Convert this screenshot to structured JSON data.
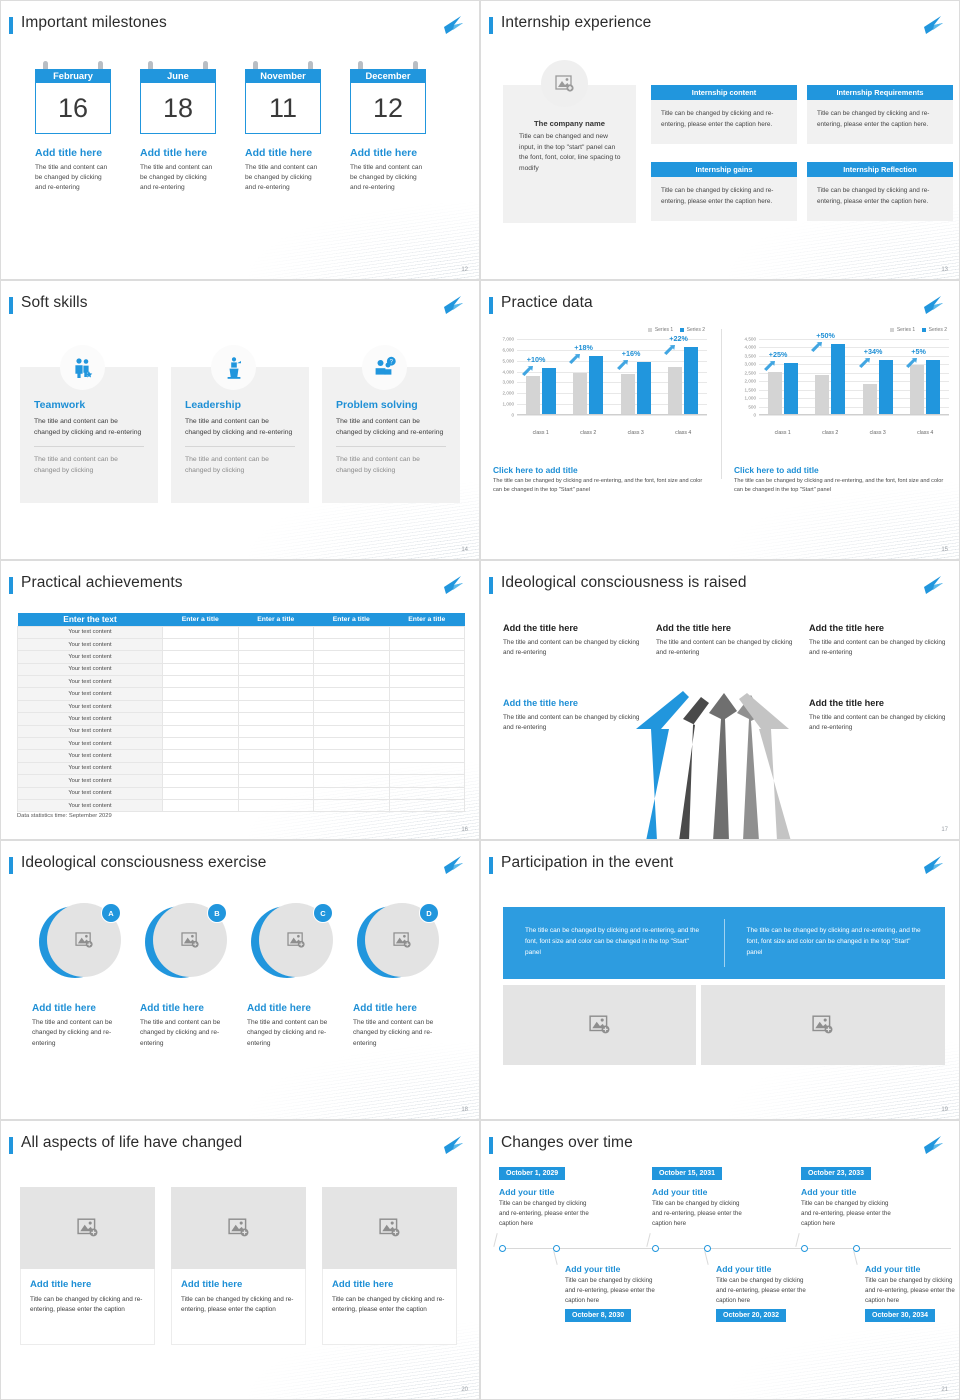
{
  "theme": {
    "accent": "#2196dd",
    "accent_dark": "#1e8fd5",
    "panel_gray": "#f1f1f1",
    "image_gray": "#e4e4e4"
  },
  "slides": [
    {
      "number": "12",
      "title": "Important milestones",
      "calendars": [
        {
          "month": "February",
          "day": "16",
          "title": "Add title here",
          "desc": "The title and content can be changed by clicking and re-entering"
        },
        {
          "month": "June",
          "day": "18",
          "title": "Add title here",
          "desc": "The title and content can be changed by clicking and re-entering"
        },
        {
          "month": "November",
          "day": "11",
          "title": "Add title here",
          "desc": "The title and content can be changed by clicking and re-entering"
        },
        {
          "month": "December",
          "day": "12",
          "title": "Add title here",
          "desc": "The title and content can be changed by clicking and re-entering"
        }
      ]
    },
    {
      "number": "13",
      "title": "Internship experience",
      "company": {
        "name": "The company name",
        "desc": "Title can be changed and new input, in the top \"start\" panel can the font, font, color, line spacing to modify"
      },
      "cells": [
        {
          "head": "Internship content",
          "body": "Title can be changed by clicking and re-entering, please enter the caption here."
        },
        {
          "head": "Internship Requirements",
          "body": "Title can be changed by clicking and re-entering, please enter the caption here."
        },
        {
          "head": "Internship gains",
          "body": "Title can be changed by clicking and re-entering, please enter the caption here."
        },
        {
          "head": "Internship Reflection",
          "body": "Title can be changed by clicking and re-entering, please enter the caption here."
        }
      ]
    },
    {
      "number": "14",
      "title": "Soft skills",
      "skills": [
        {
          "name": "Teamwork",
          "icon": "team-icon",
          "p1": "The title and content can be changed by clicking and re-entering",
          "p2": "The title and content can be changed by clicking"
        },
        {
          "name": "Leadership",
          "icon": "podium-speaker-icon",
          "p1": "The title and content can be changed by clicking and re-entering",
          "p2": "The title and content can be changed by clicking"
        },
        {
          "name": "Problem solving",
          "icon": "person-question-icon",
          "p1": "The title and content can be changed by clicking and re-entering",
          "p2": "The title and content can be changed by clicking"
        }
      ]
    },
    {
      "number": "15",
      "title": "Practice data",
      "captions": [
        {
          "title": "Click here to add title",
          "desc": "The title can be changed by clicking and re-entering, and the font, font size and color can be changed in the top \"Start\" panel"
        },
        {
          "title": "Click here to add title",
          "desc": "The title can be changed by clicking and re-entering, and the font, font size and color can be changed in the top \"Start\" panel"
        }
      ]
    },
    {
      "number": "16",
      "title": "Practical achievements",
      "table": {
        "headers": [
          "Enter the text",
          "Enter a title",
          "Enter a title",
          "Enter a title",
          "Enter a title"
        ],
        "row_label": "Your text content",
        "row_count": 15
      },
      "note": "Data statistics time: September 2029"
    },
    {
      "number": "17",
      "title": "Ideological consciousness is raised",
      "blocks": [
        {
          "title": "Add the title here",
          "desc": "The title and content can be changed by clicking and re-entering",
          "highlight": false
        },
        {
          "title": "Add the title here",
          "desc": "The title and content can be changed by clicking and re-entering",
          "highlight": false
        },
        {
          "title": "Add the title here",
          "desc": "The title and content can be changed by clicking and re-entering",
          "highlight": false
        },
        {
          "title": "Add the title here",
          "desc": "The title and content can be changed by clicking and re-entering",
          "highlight": true
        },
        {
          "title": "Add the title here",
          "desc": "The title and content can be changed by clicking and re-entering",
          "highlight": false
        }
      ]
    },
    {
      "number": "18",
      "title": "Ideological consciousness exercise",
      "items": [
        {
          "badge": "A",
          "title": "Add title here",
          "desc": "The title and content can be changed by clicking and re-entering"
        },
        {
          "badge": "B",
          "title": "Add title here",
          "desc": "The title and content can be changed by clicking and re-entering"
        },
        {
          "badge": "C",
          "title": "Add title here",
          "desc": "The title and content can be changed by clicking and re-entering"
        },
        {
          "badge": "D",
          "title": "Add title here",
          "desc": "The title and content can be changed by clicking and re-entering"
        }
      ]
    },
    {
      "number": "19",
      "title": "Participation in the event",
      "banner": [
        "The title can be changed by clicking and re-entering, and the font, font size and color can be changed in the top \"Start\" panel",
        "The title can be changed by clicking and re-entering, and the font, font size and color can be changed in the top \"Start\" panel"
      ]
    },
    {
      "number": "20",
      "title": "All aspects of life have changed",
      "cards": [
        {
          "title": "Add title here",
          "desc": "Title can be changed by clicking and re-entering, please enter the caption"
        },
        {
          "title": "Add title here",
          "desc": "Title can be changed by clicking and re-entering, please enter the caption"
        },
        {
          "title": "Add title here",
          "desc": "Title can be changed by clicking and re-entering, please enter the caption"
        }
      ]
    },
    {
      "number": "21",
      "title": "Changes over time",
      "timeline_top": [
        {
          "date": "October 1, 2029",
          "title": "Add your title",
          "desc": "Title can be changed by clicking and re-entering, please enter the caption here"
        },
        {
          "date": "October 15, 2031",
          "title": "Add your title",
          "desc": "Title can be changed by clicking and re-entering, please enter the caption here"
        },
        {
          "date": "October 23, 2033",
          "title": "Add your title",
          "desc": "Title can be changed by clicking and re-entering, please enter the caption here"
        }
      ],
      "timeline_bottom": [
        {
          "date": "October 8, 2030",
          "title": "Add your title",
          "desc": "Title can be changed by clicking and re-entering, please enter the caption here"
        },
        {
          "date": "October 20, 2032",
          "title": "Add your title",
          "desc": "Title can be changed by clicking and re-entering, please enter the caption here"
        },
        {
          "date": "October 30, 2034",
          "title": "Add your title",
          "desc": "Title can be changed by clicking and re-entering, please enter the caption here"
        }
      ]
    }
  ],
  "chart_data": [
    {
      "type": "bar",
      "title": "",
      "categories": [
        "class 1",
        "class 2",
        "class 3",
        "class 4"
      ],
      "series": [
        {
          "name": "Series 1",
          "values": [
            3500,
            3800,
            3700,
            4300
          ],
          "color": "#d4d4d4"
        },
        {
          "name": "Series 2",
          "values": [
            4200,
            5300,
            4800,
            6200
          ],
          "color": "#2196dd"
        }
      ],
      "annotations": [
        "+10%",
        "+18%",
        "+16%",
        "+22%"
      ],
      "yticks": [
        "0",
        "1,000",
        "2,000",
        "3,000",
        "4,000",
        "5,000",
        "6,000",
        "7,000"
      ],
      "ylim": [
        0,
        7000
      ],
      "xlabel": "",
      "ylabel": "",
      "grid": true,
      "legend": "top-right"
    },
    {
      "type": "bar",
      "title": "",
      "categories": [
        "class 1",
        "class 2",
        "class 3",
        "class 4"
      ],
      "series": [
        {
          "name": "Series 1",
          "values": [
            2480,
            2300,
            1800,
            2900
          ],
          "color": "#d4d4d4"
        },
        {
          "name": "Series 2",
          "values": [
            3000,
            4150,
            3200,
            3200
          ],
          "color": "#2196dd"
        }
      ],
      "annotations": [
        "+25%",
        "+50%",
        "+34%",
        "+5%"
      ],
      "yticks": [
        "0",
        "500",
        "1,000",
        "1,500",
        "2,000",
        "2,500",
        "3,000",
        "3,500",
        "4,000",
        "4,500"
      ],
      "ylim": [
        0,
        4500
      ],
      "xlabel": "",
      "ylabel": "",
      "grid": true,
      "legend": "top-right"
    }
  ]
}
